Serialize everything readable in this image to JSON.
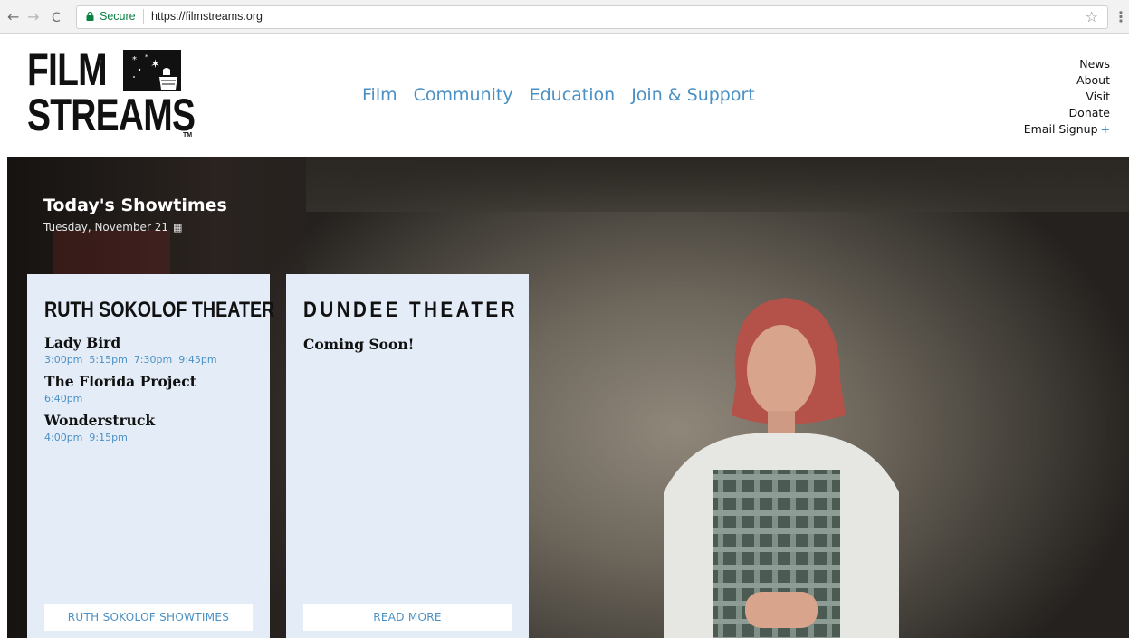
{
  "browser": {
    "secure_label": "Secure",
    "url": "https://filmstreams.org",
    "back": "←",
    "forward": "→",
    "reload": "C",
    "star": "☆",
    "menu": "⋮"
  },
  "logo": {
    "line1": "FILM",
    "line2": "STREAMS",
    "tm": "TM"
  },
  "main_nav": [
    "Film",
    "Community",
    "Education",
    "Join & Support"
  ],
  "util_nav": {
    "items": [
      "News",
      "About",
      "Visit",
      "Donate"
    ],
    "email_signup": "Email Signup",
    "email_plus": "+"
  },
  "showtimes": {
    "title": "Today's Showtimes",
    "date": "Tuesday, November 21",
    "calendar_icon": "calendar-icon"
  },
  "theaters": {
    "ruth": {
      "name": "RUTH SOKOLOF THEATER",
      "films": [
        {
          "title": "Lady Bird",
          "times": [
            "3:00pm",
            "5:15pm",
            "7:30pm",
            "9:45pm"
          ]
        },
        {
          "title": "The Florida Project",
          "times": [
            "6:40pm"
          ]
        },
        {
          "title": "Wonderstruck",
          "times": [
            "4:00pm",
            "9:15pm"
          ]
        }
      ],
      "button": "RUTH SOKOLOF SHOWTIMES"
    },
    "dundee": {
      "name": "DUNDEE THEATER",
      "coming_soon": "Coming Soon!",
      "button": "READ MORE"
    }
  },
  "colors": {
    "accent": "#4a90c4",
    "card_bg": "#e4edf7"
  }
}
